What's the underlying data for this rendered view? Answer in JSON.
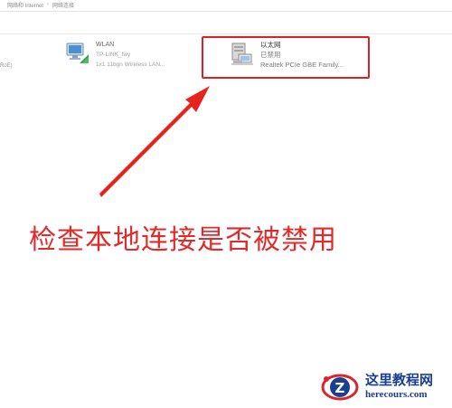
{
  "breadcrumb": {
    "items": [
      "网络和 Internet",
      "网络连接"
    ],
    "separator": "›"
  },
  "left_partial": "RoE)",
  "adapters": [
    {
      "id": "wlan",
      "name": "WLAN",
      "status": "TP-LINK_fwy",
      "device": "1x1 11bgn Wireless LAN...",
      "icon": "wifi-adapter-icon"
    },
    {
      "id": "ethernet",
      "name": "以太网",
      "status": "已禁用",
      "device": "Realtek PCIe GBE Family...",
      "icon": "ethernet-adapter-icon",
      "highlighted": true
    }
  ],
  "annotation": {
    "text": "检查本地连接是否被禁用",
    "color": "#e22a2a"
  },
  "watermark": {
    "title": "这里教程网",
    "url": "herecours.com",
    "color": "#1b3f8f",
    "accent": "#d8262b"
  }
}
